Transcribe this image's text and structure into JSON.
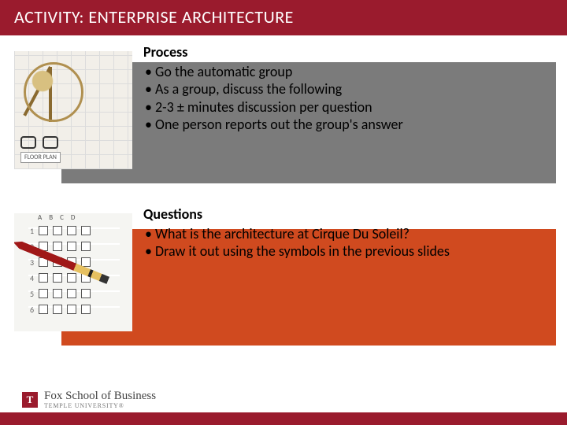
{
  "title": "ACTIVITY: ENTERPRISE ARCHITECTURE",
  "process": {
    "heading": "Process",
    "items": [
      "Go the automatic group",
      "As a group, discuss  the following",
      "2-3 ± minutes discussion per question",
      "One person reports out the group's answer"
    ]
  },
  "questions": {
    "heading": "Questions",
    "items": [
      "What is the architecture at Cirque Du Soleil?",
      "Draw it out using the symbols in the previous slides"
    ]
  },
  "footer": {
    "logo_mark": "T",
    "logo_line1": "Fox School of Business",
    "logo_line2": "TEMPLE UNIVERSITY®"
  },
  "images": {
    "process_alt": "blueprint-with-compass-and-glasses",
    "questions_alt": "answer-sheet-with-pencil",
    "floorplan_label": "FLOOR PLAN"
  },
  "colors": {
    "brand": "#9a1b2d",
    "panel_gray": "#7b7b7b",
    "panel_orange": "#d04a1f"
  }
}
